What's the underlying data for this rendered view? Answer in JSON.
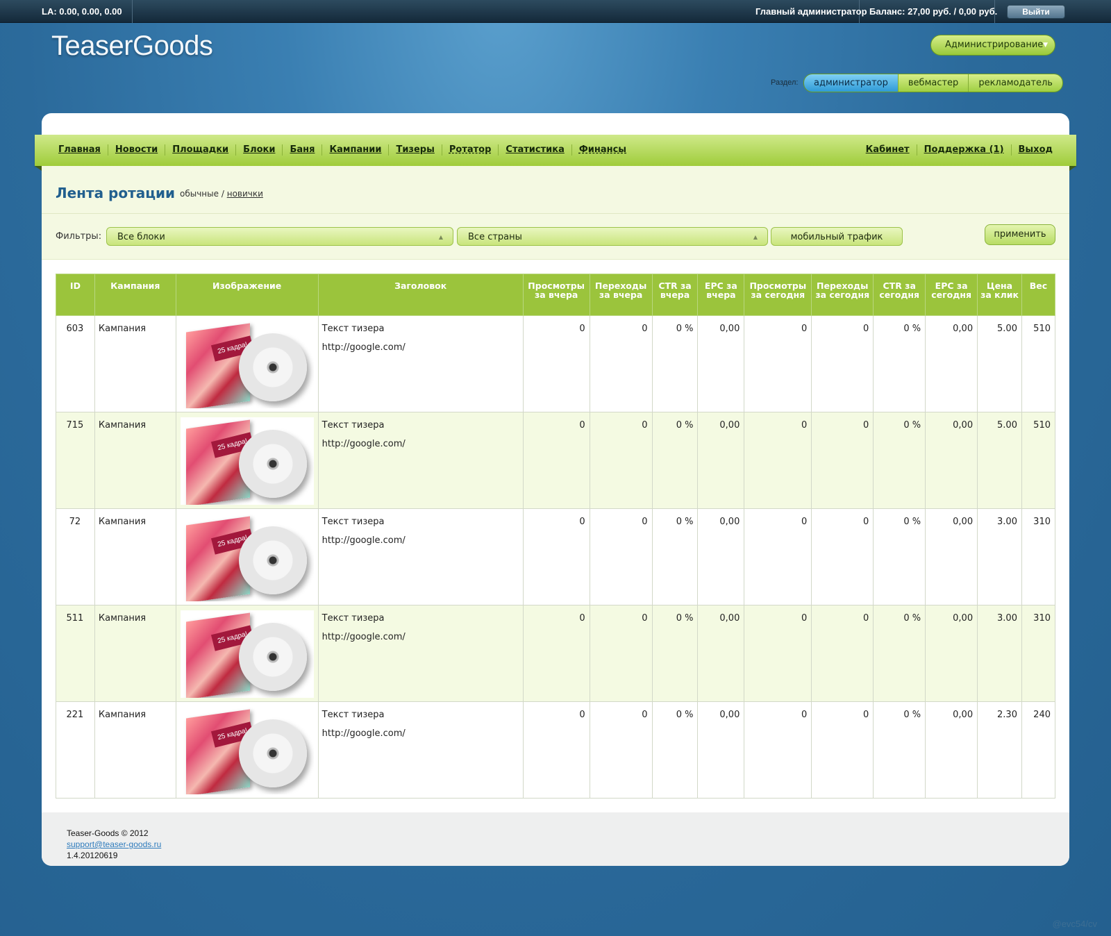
{
  "topbar": {
    "la": "LA: 0.00, 0.00, 0.00",
    "user": "Главный администратор",
    "balance": "Баланс: 27,00 руб. / 0,00 руб.",
    "logout": "Выйти"
  },
  "header": {
    "logo": "TeaserGoods",
    "admin_menu": "Администрирование",
    "section_label": "Раздел:",
    "section_tabs": [
      "администратор",
      "вебмастер",
      "рекламодатель"
    ],
    "active_section": "администратор"
  },
  "nav": {
    "left": [
      "Главная",
      "Новости",
      "Площадки",
      "Блоки",
      "Баня",
      "Кампании",
      "Тизеры",
      "Ротатор",
      "Статистика",
      "Финансы"
    ],
    "right": [
      "Кабинет",
      "Поддержка (1)",
      "Выход"
    ]
  },
  "page": {
    "title": "Лента ротации",
    "sub_current": "обычные",
    "sub_sep": "/",
    "sub_link": "новички"
  },
  "filters": {
    "label": "Фильтры:",
    "blocks": "Все блоки",
    "countries": "Все страны",
    "mobile": "мобильный трафик",
    "apply": "применить"
  },
  "table": {
    "headers": [
      "ID",
      "Кампания",
      "Изображение",
      "Заголовок",
      "Просмотры за вчера",
      "Переходы за вчера",
      "CTR за вчера",
      "EPC за вчера",
      "Просмотры за сегодня",
      "Переходы за сегодня",
      "CTR за сегодня",
      "EPC за сегодня",
      "Цена за клик",
      "Вес"
    ],
    "image_caption": "25 кадра!",
    "rows": [
      {
        "id": "603",
        "campaign": "Кампания",
        "title": "Текст тизера",
        "url": "http://google.com/",
        "views_y": "0",
        "clicks_y": "0",
        "ctr_y": "0 %",
        "epc_y": "0,00",
        "views_t": "0",
        "clicks_t": "0",
        "ctr_t": "0 %",
        "epc_t": "0,00",
        "price": "5.00",
        "weight": "510"
      },
      {
        "id": "715",
        "campaign": "Кампания",
        "title": "Текст тизера",
        "url": "http://google.com/",
        "views_y": "0",
        "clicks_y": "0",
        "ctr_y": "0 %",
        "epc_y": "0,00",
        "views_t": "0",
        "clicks_t": "0",
        "ctr_t": "0 %",
        "epc_t": "0,00",
        "price": "5.00",
        "weight": "510"
      },
      {
        "id": "72",
        "campaign": "Кампания",
        "title": "Текст тизера",
        "url": "http://google.com/",
        "views_y": "0",
        "clicks_y": "0",
        "ctr_y": "0 %",
        "epc_y": "0,00",
        "views_t": "0",
        "clicks_t": "0",
        "ctr_t": "0 %",
        "epc_t": "0,00",
        "price": "3.00",
        "weight": "310"
      },
      {
        "id": "511",
        "campaign": "Кампания",
        "title": "Текст тизера",
        "url": "http://google.com/",
        "views_y": "0",
        "clicks_y": "0",
        "ctr_y": "0 %",
        "epc_y": "0,00",
        "views_t": "0",
        "clicks_t": "0",
        "ctr_t": "0 %",
        "epc_t": "0,00",
        "price": "3.00",
        "weight": "310"
      },
      {
        "id": "221",
        "campaign": "Кампания",
        "title": "Текст тизера",
        "url": "http://google.com/",
        "views_y": "0",
        "clicks_y": "0",
        "ctr_y": "0 %",
        "epc_y": "0,00",
        "views_t": "0",
        "clicks_t": "0",
        "ctr_t": "0 %",
        "epc_t": "0,00",
        "price": "2.30",
        "weight": "240"
      }
    ]
  },
  "footer": {
    "copyright": "Teaser-Goods © 2012",
    "email": "support@teaser-goods.ru",
    "version": "1.4.20120619"
  },
  "watermark": "@evc54/cv"
}
